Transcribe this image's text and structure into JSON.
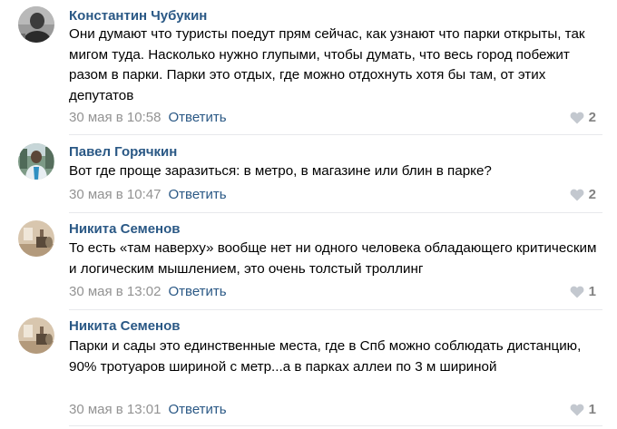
{
  "comments": [
    {
      "author": "Константин Чубукин",
      "text": "Они думают что туристы поедут прям сейчас, как узнают что парки открыты, так мигом туда. Насколько нужно глупыми, чтобы думать, что весь город побежит разом в парки. Парки это отдых, где можно отдохнуть хотя бы там, от этих депутатов",
      "date": "30 мая в 10:58",
      "reply_label": "Ответить",
      "likes": "2",
      "avatar_icon": "grayscale-portrait"
    },
    {
      "author": "Павел Горячкин",
      "text": "Вот где проще заразиться: в метро, в магазине или блин в парке?",
      "date": "30 мая в 10:47",
      "reply_label": "Ответить",
      "likes": "2",
      "avatar_icon": "outdoor-portrait"
    },
    {
      "author": "Никита Семенов",
      "text": "То есть «там наверху» вообще нет ни одного человека обладающего критическим и логическим мышлением, это очень толстый троллинг",
      "date": "30 мая в 13:02",
      "reply_label": "Ответить",
      "likes": "1",
      "avatar_icon": "room-photo"
    },
    {
      "author": "Никита Семенов",
      "text": "Парки и сады это единственные места, где в Спб можно соблюдать дистанцию, 90% тротуаров шириной с метр...а в парках аллеи по 3 м шириной",
      "date": "30 мая в 13:01",
      "reply_label": "Ответить",
      "likes": "1",
      "avatar_icon": "room-photo"
    }
  ],
  "colors": {
    "author": "#2a5885",
    "reply": "#2a5885",
    "date": "#939393",
    "likes": "#828282",
    "divider": "#e7e8ec"
  }
}
